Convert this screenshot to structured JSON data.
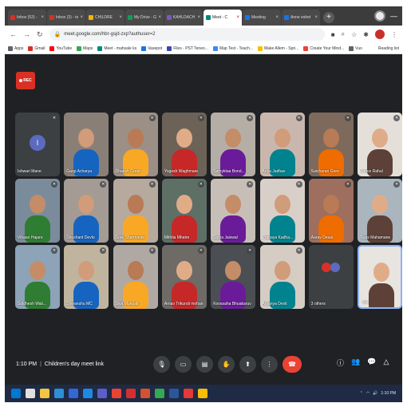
{
  "browser": {
    "tabs": [
      {
        "label": "Inbox (52) -",
        "icon_color": "#d93025"
      },
      {
        "label": "Inbox (3) - te",
        "icon_color": "#d93025"
      },
      {
        "label": "CHILDRE",
        "icon_color": "#f4b400"
      },
      {
        "label": "My Drive - Go",
        "icon_color": "#0f9d58"
      },
      {
        "label": "KAHLDACH",
        "icon_color": "#7e57c2"
      },
      {
        "label": "Meet - C",
        "icon_color": "#00897b",
        "active": true
      },
      {
        "label": "Meeting",
        "icon_color": "#1a73e8"
      },
      {
        "label": "Anne eshet",
        "icon_color": "#1a73e8"
      }
    ],
    "new_tab_label": "+",
    "url": "meet.google.com/hbr-gsjd-zxp?authuser=2",
    "bookmarks": [
      {
        "label": "Apps",
        "icon_color": "#5f6368"
      },
      {
        "label": "Gmail",
        "icon_color": "#d93025"
      },
      {
        "label": "YouTube",
        "icon_color": "#ff0000"
      },
      {
        "label": "Maps",
        "icon_color": "#34a853"
      },
      {
        "label": "Meet - mahsale ks",
        "icon_color": "#00897b"
      },
      {
        "label": "Vasepot",
        "icon_color": "#1a73e8"
      },
      {
        "label": "Files - PST Teneo...",
        "icon_color": "#3949ab"
      },
      {
        "label": "Map Test - Teach...",
        "icon_color": "#4285f4"
      },
      {
        "label": "Make Allem - Spri...",
        "icon_color": "#fbbc04"
      },
      {
        "label": "Create Your Mind...",
        "icon_color": "#ea4335"
      },
      {
        "label": "Vuo",
        "icon_color": "#5f6368"
      }
    ],
    "bookmarks_right": "Reading list"
  },
  "meet": {
    "rec_label": "REC",
    "participants": [
      {
        "name": "Ishwari Mane",
        "avatar_letter": "I",
        "mic_off": true
      },
      {
        "name": "Gargi Acharya",
        "mic_off": false
      },
      {
        "name": "Dhansh Gorai",
        "mic_off": true
      },
      {
        "name": "Yogesh Waghmare",
        "mic_off": true
      },
      {
        "name": "Samyktaa Bond...",
        "mic_off": true
      },
      {
        "name": "Anya Jadhav",
        "mic_off": true
      },
      {
        "name": "Saicharan Gore",
        "mic_off": true
      },
      {
        "name": "Prince Rahul",
        "mic_off": true
      },
      {
        "name": "Vihaan Hajare",
        "mic_off": true
      },
      {
        "name": "Shushant Devlo",
        "mic_off": true
      },
      {
        "name": "Sree Sharmante",
        "mic_off": true
      },
      {
        "name": "Mithila Mhatre",
        "mic_off": true
      },
      {
        "name": "Sonia Jaiswal",
        "mic_off": true
      },
      {
        "name": "Pranaya Kadha...",
        "mic_off": true
      },
      {
        "name": "Aarav Desai",
        "mic_off": true
      },
      {
        "name": "Tejas Mahamane",
        "mic_off": true
      },
      {
        "name": "Siddhesh Wali...",
        "mic_off": true
      },
      {
        "name": "Shivanshu MC",
        "mic_off": true
      },
      {
        "name": "Siya Mungali",
        "mic_off": true
      },
      {
        "name": "Arnav Trikundi mohan",
        "mic_off": true
      },
      {
        "name": "Kovasaha Bhuakaruv",
        "mic_off": true
      },
      {
        "name": "Aryanya Dexit",
        "mic_off": true
      },
      {
        "name": "3 others",
        "others": true
      },
      {
        "name": "You",
        "self": true
      }
    ],
    "time": "1:10 PM",
    "separator": "|",
    "meeting_name": "Children's day meet link",
    "controls": [
      {
        "name": "mic",
        "glyph": "🎙"
      },
      {
        "name": "camera",
        "glyph": "▭"
      },
      {
        "name": "captions",
        "glyph": "▤"
      },
      {
        "name": "raise-hand",
        "glyph": "✋"
      },
      {
        "name": "present",
        "glyph": "⬆"
      },
      {
        "name": "more-options",
        "glyph": "⋮"
      },
      {
        "name": "end-call",
        "glyph": "☎"
      }
    ],
    "right_controls": [
      {
        "name": "info",
        "glyph": "ⓘ"
      },
      {
        "name": "people",
        "glyph": "👥"
      },
      {
        "name": "chat",
        "glyph": "💬"
      },
      {
        "name": "activities",
        "glyph": "△"
      }
    ]
  },
  "taskbar": {
    "apps": [
      {
        "name": "start",
        "color": "#0078d4"
      },
      {
        "name": "search",
        "color": "#e0e0e0"
      },
      {
        "name": "file-explorer",
        "color": "#f4c542"
      },
      {
        "name": "edge",
        "color": "#2d8fd5"
      },
      {
        "name": "store",
        "color": "#3367d6"
      },
      {
        "name": "mail",
        "color": "#1e88e5"
      },
      {
        "name": "teams",
        "color": "#5b5fc7"
      },
      {
        "name": "chrome",
        "color": "#ea4335"
      },
      {
        "name": "opera",
        "color": "#d32f2f"
      },
      {
        "name": "powerpoint",
        "color": "#d35230"
      },
      {
        "name": "chrome-2",
        "color": "#34a853"
      },
      {
        "name": "word",
        "color": "#2b579a"
      },
      {
        "name": "acrobat",
        "color": "#e53935"
      },
      {
        "name": "chrome-3",
        "color": "#fbbc04"
      }
    ],
    "tray_text": "1:10 PM"
  }
}
